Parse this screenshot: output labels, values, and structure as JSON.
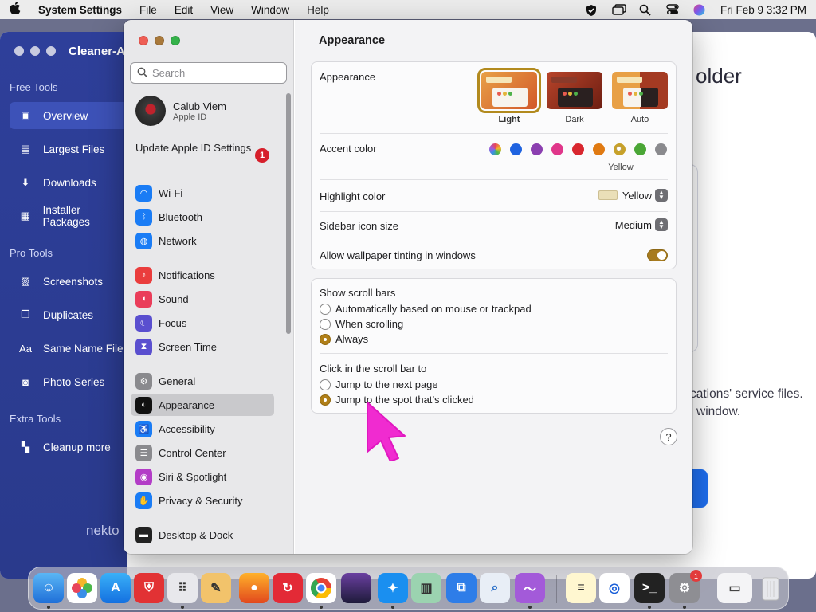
{
  "menubar": {
    "app_name": "System Settings",
    "menus": [
      "File",
      "Edit",
      "View",
      "Window",
      "Help"
    ],
    "clock": "Fri Feb 9  3:32 PM"
  },
  "background_app": {
    "title": "Cleaner-A",
    "sections": {
      "free": "Free Tools",
      "pro": "Pro Tools",
      "extra": "Extra Tools"
    },
    "free_items": [
      "Overview",
      "Largest Files",
      "Downloads",
      "Installer Packages"
    ],
    "pro_items": [
      "Screenshots",
      "Duplicates",
      "Same Name Files",
      "Photo Series"
    ],
    "extra_items": [
      "Cleanup more"
    ],
    "brand": "nekto",
    "heading_fragment": "older",
    "text_line1": "cations' service files.",
    "text_line2": "window."
  },
  "sidebar": {
    "search_placeholder": "Search",
    "user_name": "Calub Viem",
    "user_sub": "Apple ID",
    "update_text": "Update Apple ID Settings",
    "update_badge": "1",
    "items": [
      {
        "label": "Wi-Fi",
        "icon": "wifi-icon",
        "color": "#1a7cf5"
      },
      {
        "label": "Bluetooth",
        "icon": "bluetooth-icon",
        "color": "#1a7cf5"
      },
      {
        "label": "Network",
        "icon": "globe-icon",
        "color": "#1a7cf5"
      },
      {
        "label": "Notifications",
        "icon": "bell-icon",
        "color": "#ea3d3d"
      },
      {
        "label": "Sound",
        "icon": "speaker-icon",
        "color": "#ea3d5a"
      },
      {
        "label": "Focus",
        "icon": "moon-icon",
        "color": "#5a4fcf"
      },
      {
        "label": "Screen Time",
        "icon": "hourglass-icon",
        "color": "#5a4fcf"
      },
      {
        "label": "General",
        "icon": "gear-icon",
        "color": "#8a8a8e"
      },
      {
        "label": "Appearance",
        "icon": "appearance-icon",
        "color": "#111111"
      },
      {
        "label": "Accessibility",
        "icon": "accessibility-icon",
        "color": "#1a7cf5"
      },
      {
        "label": "Control Center",
        "icon": "control-center-icon",
        "color": "#8a8a8e"
      },
      {
        "label": "Siri & Spotlight",
        "icon": "siri-icon",
        "color": "#b33cc7"
      },
      {
        "label": "Privacy & Security",
        "icon": "hand-icon",
        "color": "#1a7cf5"
      },
      {
        "label": "Desktop & Dock",
        "icon": "dock-icon",
        "color": "#222222"
      }
    ]
  },
  "main": {
    "title": "Appearance",
    "appearance_label": "Appearance",
    "appearance_options": [
      "Light",
      "Dark",
      "Auto"
    ],
    "appearance_selected": "Light",
    "accent_label": "Accent color",
    "accent_colors": [
      "multicolor",
      "#1f63e0",
      "#8b3fb0",
      "#e0368a",
      "#d9272f",
      "#e07a12",
      "#c7a12a",
      "#4aa636",
      "#8a8a8e"
    ],
    "accent_selected_name": "Yellow",
    "highlight_label": "Highlight color",
    "highlight_value": "Yellow",
    "sidebar_icon_label": "Sidebar icon size",
    "sidebar_icon_value": "Medium",
    "wallpaper_label": "Allow wallpaper tinting in windows",
    "wallpaper_on": true,
    "scroll_label": "Show scroll bars",
    "scroll_options": [
      "Automatically based on mouse or trackpad",
      "When scrolling",
      "Always"
    ],
    "scroll_selected": "Always",
    "click_label": "Click in the scroll bar to",
    "click_options": [
      "Jump to the next page",
      "Jump to the spot that’s clicked"
    ],
    "click_selected": "Jump to the spot that’s clicked",
    "help": "?"
  },
  "dock": {
    "badge_settings": "1"
  }
}
